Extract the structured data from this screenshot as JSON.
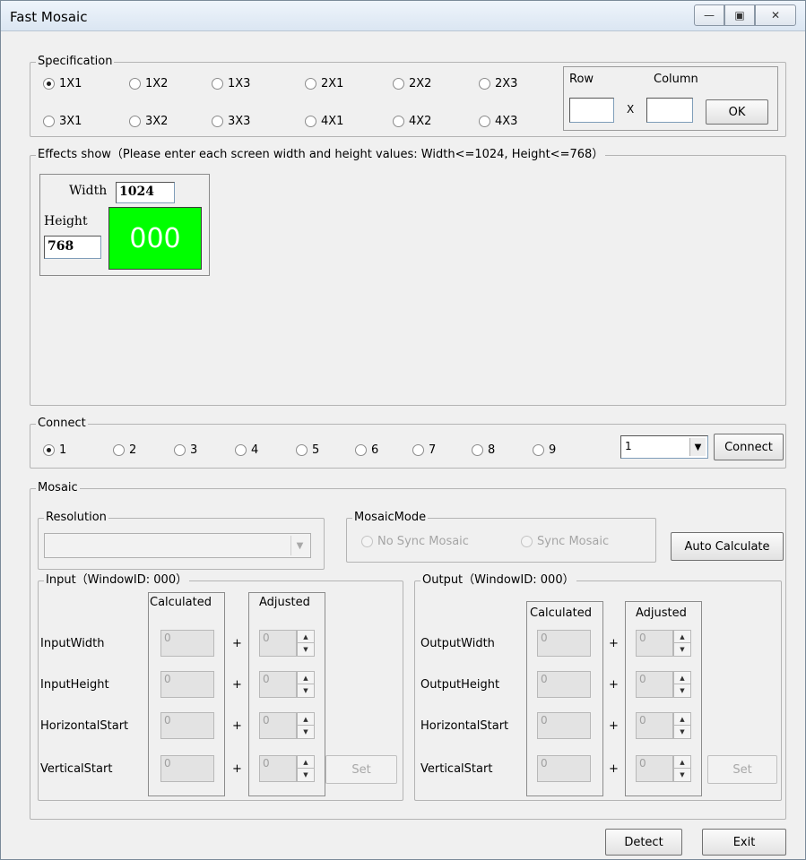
{
  "window": {
    "title": "Fast Mosaic",
    "minimize_glyph": "—",
    "restore_glyph": "▣",
    "close_glyph": "✕"
  },
  "specification": {
    "legend": "Specification",
    "options_row1": [
      "1X1",
      "1X2",
      "1X3",
      "2X1",
      "2X2",
      "2X3"
    ],
    "options_row2": [
      "3X1",
      "3X2",
      "3X3",
      "4X1",
      "4X2",
      "4X3"
    ],
    "selected": "1X1",
    "row_label": "Row",
    "column_label": "Column",
    "x_label": "X",
    "row_value": "",
    "column_value": "",
    "ok_label": "OK"
  },
  "effects": {
    "legend": "Effects show（Please enter each screen width and height values: Width<=1024, Height<=768）",
    "width_label": "Width",
    "width_value": "1024",
    "height_label": "Height",
    "height_value": "768",
    "screen_id": "000",
    "screen_color": "#00ff00"
  },
  "connect": {
    "legend": "Connect",
    "options": [
      "1",
      "2",
      "3",
      "4",
      "5",
      "6",
      "7",
      "8",
      "9"
    ],
    "selected": "1",
    "dropdown_value": "1",
    "connect_label": "Connect"
  },
  "mosaic": {
    "legend": "Mosaic",
    "resolution_legend": "Resolution",
    "resolution_value": "",
    "mode_legend": "MosaicMode",
    "mode_no_sync": "No Sync Mosaic",
    "mode_sync": "Sync Mosaic",
    "auto_calculate_label": "Auto Calculate",
    "input": {
      "legend": "Input（WindowID: 000）",
      "calculated_header": "Calculated",
      "adjusted_header": "Adjusted",
      "plus": "+",
      "rows": [
        {
          "label": "InputWidth",
          "calc": "0",
          "adj": "0"
        },
        {
          "label": "InputHeight",
          "calc": "0",
          "adj": "0"
        },
        {
          "label": "HorizontalStart",
          "calc": "0",
          "adj": "0"
        },
        {
          "label": "VerticalStart",
          "calc": "0",
          "adj": "0"
        }
      ],
      "set_label": "Set"
    },
    "output": {
      "legend": "Output（WindowID: 000）",
      "calculated_header": "Calculated",
      "adjusted_header": "Adjusted",
      "plus": "+",
      "rows": [
        {
          "label": "OutputWidth",
          "calc": "0",
          "adj": "0"
        },
        {
          "label": "OutputHeight",
          "calc": "0",
          "adj": "0"
        },
        {
          "label": "HorizontalStart",
          "calc": "0",
          "adj": "0"
        },
        {
          "label": "VerticalStart",
          "calc": "0",
          "adj": "0"
        }
      ],
      "set_label": "Set"
    }
  },
  "footer": {
    "detect_label": "Detect",
    "exit_label": "Exit"
  }
}
